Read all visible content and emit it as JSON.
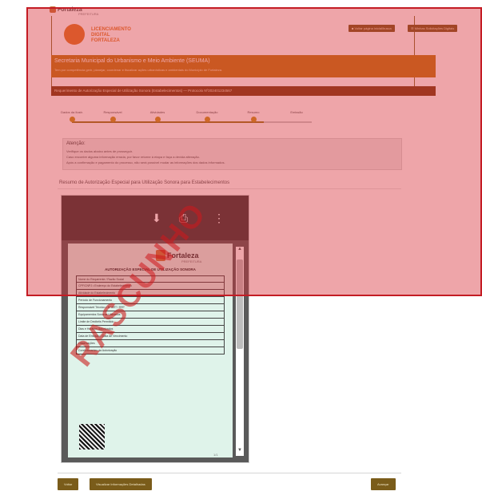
{
  "topbar": {
    "logo_label": "Fortaleza",
    "logo_sub": "PREFEITURA"
  },
  "branding": {
    "line1": "LICENCIAMENTO",
    "line2": "DIGITAL",
    "line3": "FORTALEZA"
  },
  "header_buttons": {
    "left": "■ Voltar página inicial/busca",
    "right": "☰ Minhas Solicitações Digitais"
  },
  "secretaria": {
    "title": "Secretaria Municipal do Urbanismo e Meio Ambiente (SEUMA)",
    "subtitle": "Tem por competência gerir, planejar, coordenar e fiscalizar ações urbanísticas e ambientais do Município de Fortaleza."
  },
  "process_title": "Requerimento de Autorização Especial de Utilização Sonora (Estabelecimentos) — Protocolo Nº202401234567",
  "stepper": {
    "steps": [
      {
        "label": "Dados da Ilustr."
      },
      {
        "label": "Responsável"
      },
      {
        "label": "Atividades"
      },
      {
        "label": "Documentação"
      },
      {
        "label": "Resumo"
      },
      {
        "label": "Emissão"
      }
    ]
  },
  "attention": {
    "title": "Atenção:",
    "lines": [
      "Verifique os dados abaixo antes de prosseguir.",
      "Caso encontre alguma informação errada, por favor retorne à etapa e faça a devida alteração.",
      "Após a confirmação e pagamento do processo, não será possível mudar as informações dos dados informados."
    ]
  },
  "resumo": {
    "title": "Resumo de Autorização Especial para Utilização Sonora para Estabelecimentos"
  },
  "viewer": {
    "download_icon": "download-icon",
    "print_icon": "print-icon",
    "more_icon": "more-vertical-icon"
  },
  "document": {
    "brand": "Fortaleza",
    "brand_sub": "PREFEITURA",
    "title": "AUTORIZAÇÃO ESPECIAL DE UTILIZAÇÃO SONORA",
    "rows": [
      "Nome do Requerente / Razão Social",
      "CPF/CNPJ   •   Endereço do Estabelecimento",
      "Atividade do Estabelecimento",
      "Período de Funcionamento",
      "Responsável Técnico   •   Nº ART / RRT",
      "Equipamentos Sonoros Utilizados",
      "Limite de Decibéis Permitido",
      "Dias e Horários Autorizados",
      "Data de Emissão   •   Data de Vencimento",
      "Observações",
      "Condicionantes da Autorização"
    ],
    "page_number": "1/1"
  },
  "watermark": "RASCUNHO",
  "footer": {
    "back_label": "Voltar",
    "preview_label": "Visualizar Informações Detalhadas",
    "next_label": "Avançar"
  },
  "colors": {
    "overlay": "#d62832",
    "brand_orange": "#e07a2a",
    "secretaria_bar": "#c17b18",
    "step_header": "#7b4116",
    "button_brown": "#7a5c1a"
  }
}
